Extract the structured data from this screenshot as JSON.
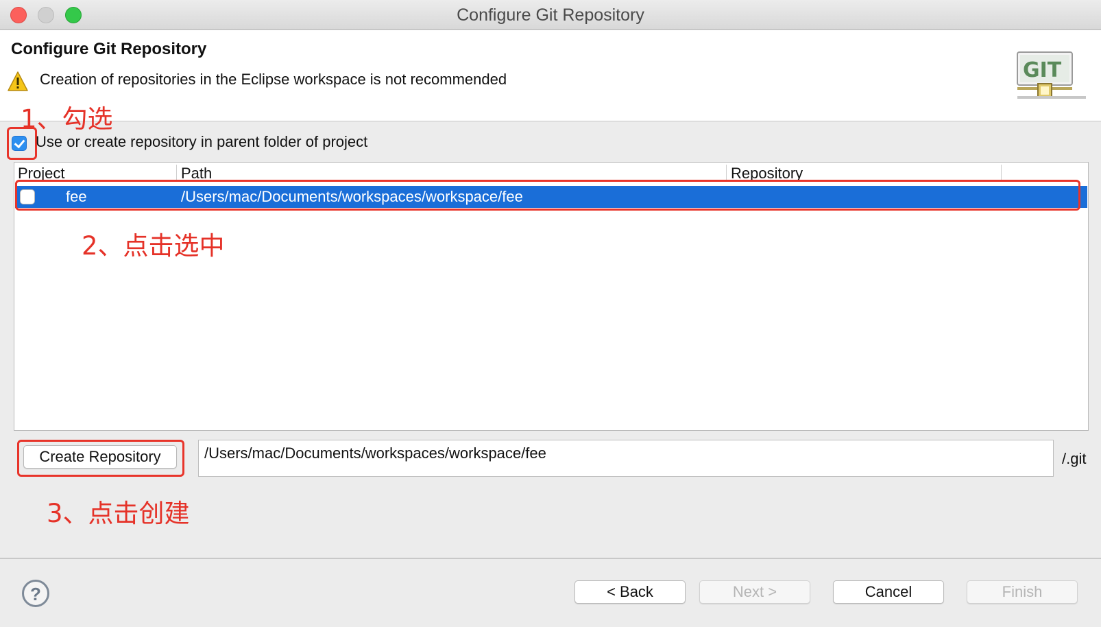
{
  "window": {
    "title": "Configure Git Repository"
  },
  "header": {
    "title": "Configure Git Repository",
    "message": "Creation of repositories in the Eclipse workspace is not recommended",
    "logo_text": "GIT"
  },
  "annotations": {
    "step1": "1、勾选",
    "step2": "2、点击选中",
    "step3": "3、点击创建"
  },
  "options": {
    "use_parent_folder": {
      "label": "Use or create repository in parent folder of project",
      "checked": true
    }
  },
  "table": {
    "columns": [
      "Project",
      "Path",
      "Repository"
    ],
    "rows": [
      {
        "checked": false,
        "project": "fee",
        "path": "/Users/mac/Documents/workspaces/workspace/fee",
        "repository": "",
        "selected": true
      }
    ]
  },
  "create": {
    "button_label": "Create Repository",
    "path_value": "/Users/mac/Documents/workspaces/workspace/fee",
    "suffix": "/.git"
  },
  "footer": {
    "help_symbol": "?",
    "back_label": "< Back",
    "next_label": "Next >",
    "cancel_label": "Cancel",
    "finish_label": "Finish"
  },
  "colors": {
    "selection": "#1a6ed8",
    "annotation": "#e53228",
    "checkbox_accent": "#2d8ff0"
  }
}
